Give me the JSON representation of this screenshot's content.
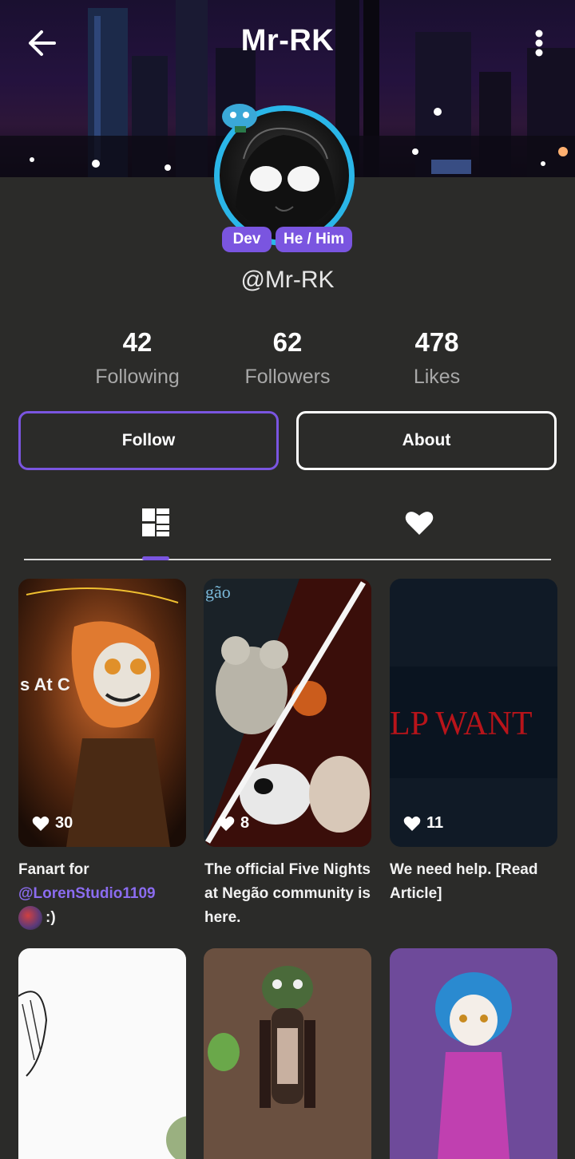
{
  "header": {
    "title": "Mr-RK",
    "back_icon": "arrow-left-icon",
    "more_icon": "more-vertical-icon"
  },
  "profile": {
    "handle": "@Mr-RK",
    "badges": [
      "Dev",
      "He / Him"
    ],
    "accent_color": "#7a55e0",
    "ring_color": "#2ab6e8"
  },
  "stats": [
    {
      "value": "42",
      "label": "Following"
    },
    {
      "value": "62",
      "label": "Followers"
    },
    {
      "value": "478",
      "label": "Likes"
    }
  ],
  "actions": {
    "follow_label": "Follow",
    "about_label": "About"
  },
  "tabs": [
    {
      "icon": "grid-layout-icon",
      "selected": true
    },
    {
      "icon": "heart-icon",
      "selected": false
    }
  ],
  "posts": [
    {
      "likes": "30",
      "caption_text": "Fanart for",
      "mention": "@LorenStudio1109",
      "suffix": ":)",
      "thumb_text": "s At C"
    },
    {
      "likes": "8",
      "caption_text": "The official Five Nights at Negão community is here.",
      "thumb_text": "gão"
    },
    {
      "likes": "11",
      "caption_text": "We need help. [Read Article]",
      "thumb_text": "LP WANT"
    },
    {
      "thumb_text": ""
    },
    {
      "thumb_text": ""
    },
    {
      "thumb_text": ""
    }
  ]
}
